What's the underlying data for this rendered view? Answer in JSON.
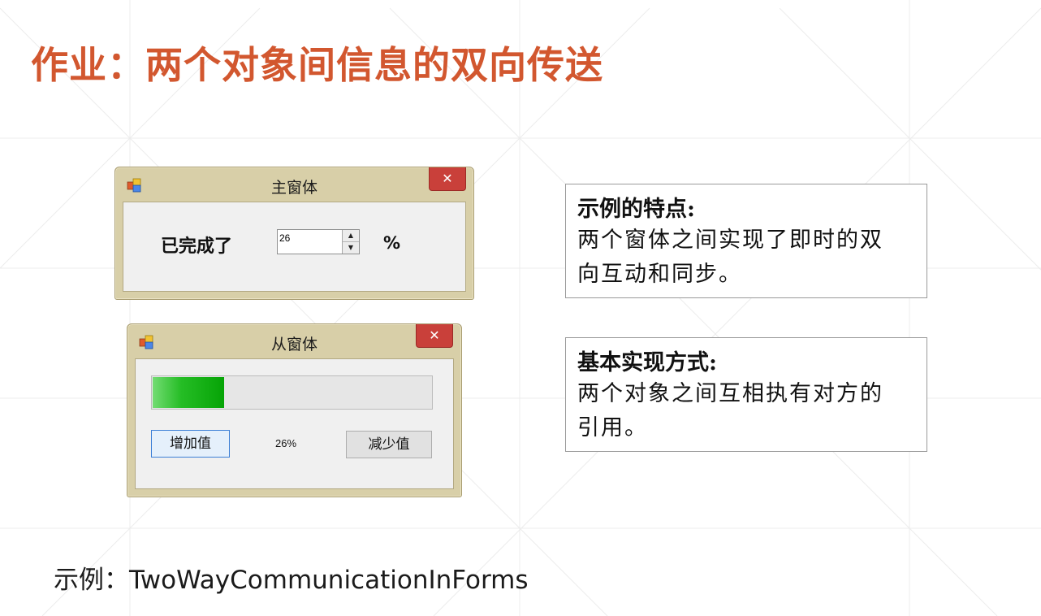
{
  "slide": {
    "title": "作业：两个对象间信息的双向传送",
    "accent_color": "#d2572f"
  },
  "main_window": {
    "title": "主窗体",
    "icon": "winforms-app-icon",
    "close_glyph": "✕",
    "label": "已完成了",
    "spinner_value": "26",
    "percent_sign": "%"
  },
  "sub_window": {
    "title": "从窗体",
    "icon": "winforms-app-icon",
    "close_glyph": "✕",
    "progress_percent": 26,
    "increase_button": "增加值",
    "percent_text": "26%",
    "decrease_button": "减少值"
  },
  "notes": {
    "features": {
      "title": "示例的特点:",
      "body": "两个窗体之间实现了即时的双向互动和同步。"
    },
    "method": {
      "title": "基本实现方式:",
      "body": "两个对象之间互相执有对方的引用。"
    }
  },
  "example": {
    "prefix": "示例：",
    "name": "TwoWayCommunicationInForms"
  }
}
